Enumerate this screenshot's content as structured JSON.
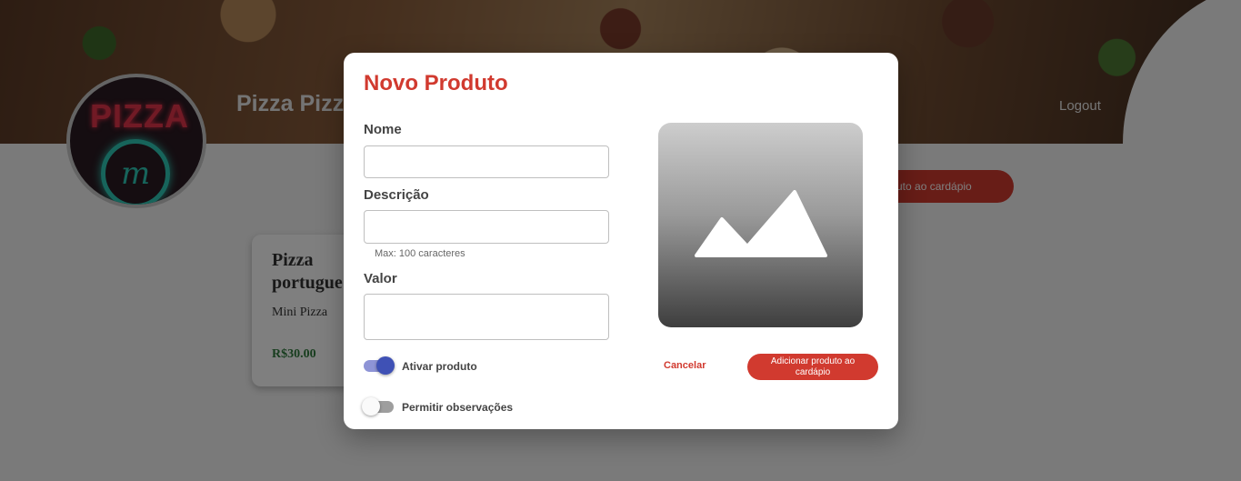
{
  "header": {
    "restaurant_name": "Pizza Pizz",
    "logout_label": "Logout",
    "avatar_text": "PIZZA",
    "avatar_monogram": "m"
  },
  "page": {
    "add_button_label": "uto ao cardápio"
  },
  "product_card": {
    "name": "Pizza portugue",
    "description": "Mini Pizza",
    "price": "R$30.00"
  },
  "modal": {
    "title": "Novo Produto",
    "fields": {
      "name_label": "Nome",
      "name_value": "",
      "description_label": "Descrição",
      "description_value": "",
      "description_helper": "Max: 100 caracteres",
      "value_label": "Valor",
      "value_value": ""
    },
    "image_placeholder_icon": "image-icon",
    "toggles": [
      {
        "label": "Ativar produto",
        "on": true
      },
      {
        "label": "Permitir observações",
        "on": false
      }
    ],
    "cancel_label": "Cancelar",
    "submit_label": "Adicionar produto ao cardápio"
  },
  "colors": {
    "accent": "#d13a2f",
    "toggle_on": "#3f51b5",
    "price": "#2f7a3d"
  }
}
